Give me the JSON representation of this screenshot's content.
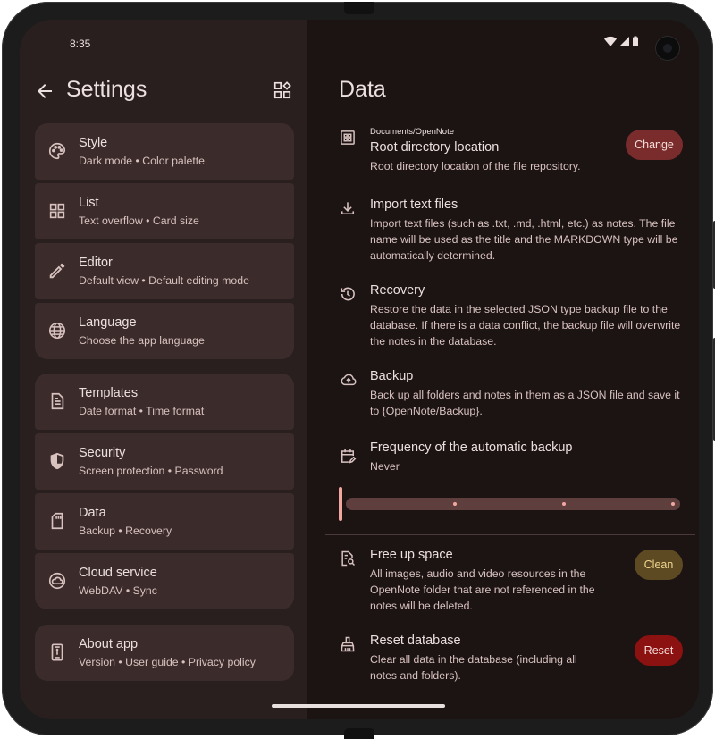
{
  "status": {
    "time": "8:35"
  },
  "left_panel": {
    "title": "Settings",
    "groups": [
      [
        {
          "title": "Style",
          "subtitle": "Dark mode  •  Color palette",
          "icon": "palette-icon"
        },
        {
          "title": "List",
          "subtitle": "Text overflow  •  Card size",
          "icon": "grid-view-icon"
        },
        {
          "title": "Editor",
          "subtitle": "Default view • Default editing mode",
          "icon": "pencil-icon"
        },
        {
          "title": "Language",
          "subtitle": "Choose the app language",
          "icon": "globe-icon"
        }
      ],
      [
        {
          "title": "Templates",
          "subtitle": "Date format  •  Time format",
          "icon": "document-icon"
        },
        {
          "title": "Security",
          "subtitle": "Screen protection  •  Password",
          "icon": "shield-icon"
        },
        {
          "title": "Data",
          "subtitle": "Backup  •  Recovery",
          "icon": "sd-card-icon"
        },
        {
          "title": "Cloud service",
          "subtitle": "WebDAV  •  Sync",
          "icon": "cloud-circle-icon"
        }
      ],
      [
        {
          "title": "About app",
          "subtitle": "Version  •  User guide  •  Privacy policy",
          "icon": "phone-info-icon"
        }
      ]
    ]
  },
  "right_panel": {
    "title": "Data",
    "root_dir": {
      "path": "Documents/OpenNote",
      "title": "Root directory location",
      "desc": "Root directory location of the file repository.",
      "button": "Change"
    },
    "import": {
      "title": "Import text files",
      "desc": "Import text files (such as .txt, .md, .html, etc.) as notes. The file name will be used as the title and the MARKDOWN type will be automatically determined."
    },
    "recovery": {
      "title": "Recovery",
      "desc": "Restore the data in the selected JSON type backup file to the database. If there is a data conflict, the backup file will overwrite the notes in the database."
    },
    "backup": {
      "title": "Backup",
      "desc": "Back up all folders and notes in them as a JSON file and save it to {OpenNote/Backup}."
    },
    "frequency": {
      "title": "Frequency of the automatic backup",
      "value": "Never",
      "slider_level": 0,
      "slider_steps": 3
    },
    "free_space": {
      "title": "Free up space",
      "desc": "All images, audio and video resources in the OpenNote folder that are not referenced in the notes will be deleted.",
      "button": "Clean"
    },
    "reset": {
      "title": "Reset database",
      "desc": "Clear all data in the database (including all notes and folders).",
      "button": "Reset"
    }
  },
  "colors": {
    "accent": "#f2a79e",
    "change_button": "#7a2c2c",
    "clean_button": "#5d4a22",
    "reset_button": "#8c1111"
  }
}
